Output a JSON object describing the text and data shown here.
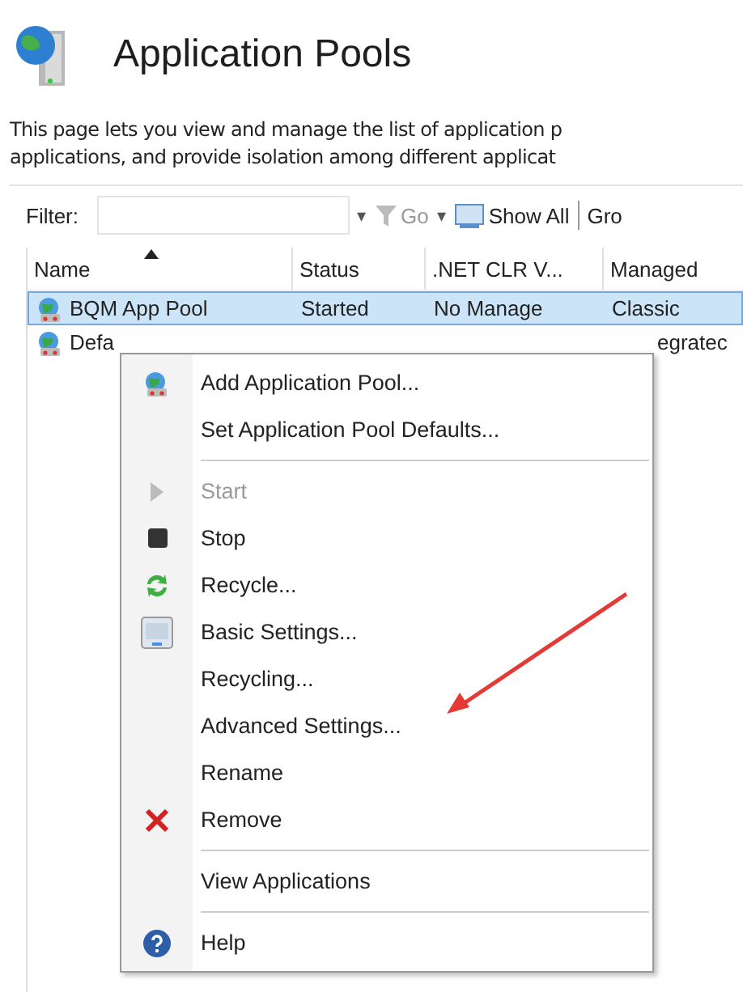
{
  "header": {
    "title": "Application Pools"
  },
  "description": [
    "This page lets you view and manage the list of application p",
    "applications, and provide isolation among different applicat"
  ],
  "toolbar": {
    "filter_label": "Filter:",
    "dropdown": "▾",
    "go": "Go",
    "go_caret": "▾",
    "show_all": "Show All",
    "group": "Gro"
  },
  "table": {
    "columns": [
      {
        "label": "Name",
        "sorted": true
      },
      {
        "label": "Status",
        "sorted": false
      },
      {
        "label": ".NET CLR V...",
        "sorted": false
      },
      {
        "label": "Managed",
        "sorted": false
      }
    ],
    "rows": [
      {
        "cells": [
          "BQM App Pool",
          "Started",
          "No Manage",
          "Classic"
        ],
        "selected": true
      },
      {
        "cells": [
          "Defa",
          "",
          "",
          "egratec"
        ],
        "selected": false
      }
    ]
  },
  "context_menu": [
    {
      "kind": "item",
      "label": "Add Application Pool...",
      "disabled": false
    },
    {
      "kind": "item",
      "label": "Set Application Pool Defaults...",
      "disabled": false
    },
    {
      "kind": "separator"
    },
    {
      "kind": "item",
      "label": "Start",
      "disabled": true
    },
    {
      "kind": "item",
      "label": "Stop",
      "disabled": false
    },
    {
      "kind": "item",
      "label": "Recycle...",
      "disabled": false
    },
    {
      "kind": "item",
      "label": "Basic Settings...",
      "disabled": false
    },
    {
      "kind": "item",
      "label": "Recycling...",
      "disabled": false
    },
    {
      "kind": "item",
      "label": "Advanced Settings...",
      "disabled": false
    },
    {
      "kind": "item",
      "label": "Rename",
      "disabled": false
    },
    {
      "kind": "item",
      "label": "Remove",
      "disabled": false
    },
    {
      "kind": "separator"
    },
    {
      "kind": "item",
      "label": "View Applications",
      "disabled": false
    },
    {
      "kind": "separator"
    },
    {
      "kind": "item",
      "label": "Help",
      "disabled": false
    }
  ]
}
